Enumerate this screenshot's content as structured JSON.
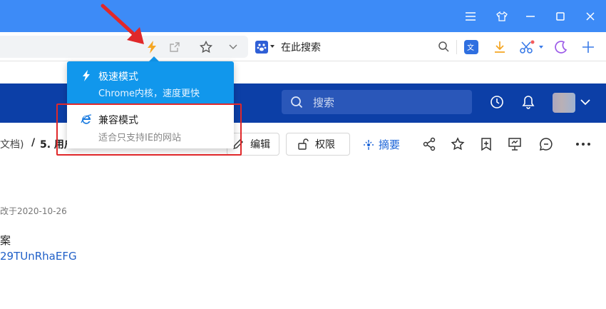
{
  "toolbar": {
    "search_text": "在此搜索"
  },
  "popup": {
    "fast_title": "极速模式",
    "fast_desc": "Chrome内核，速度更快",
    "compat_title": "兼容模式",
    "compat_desc": "适合只支持IE的网站"
  },
  "appheader": {
    "search_placeholder": "搜索"
  },
  "content": {
    "breadcrumb_parent": "文档)",
    "breadcrumb_sep": "/",
    "breadcrumb_current": "5. 用户",
    "edit_label": "编辑",
    "permission_label": "权限",
    "summary_label": "摘要",
    "date_text": "改于2020-10-26",
    "para_text": "案",
    "link_text": "29TUnRhaEFG"
  },
  "colors": {
    "titlebar": "#3d8bf7",
    "appheader": "#0c3fa7",
    "popup_active": "#1197ec",
    "highlight": "#e0282a",
    "link": "#2060c8"
  }
}
